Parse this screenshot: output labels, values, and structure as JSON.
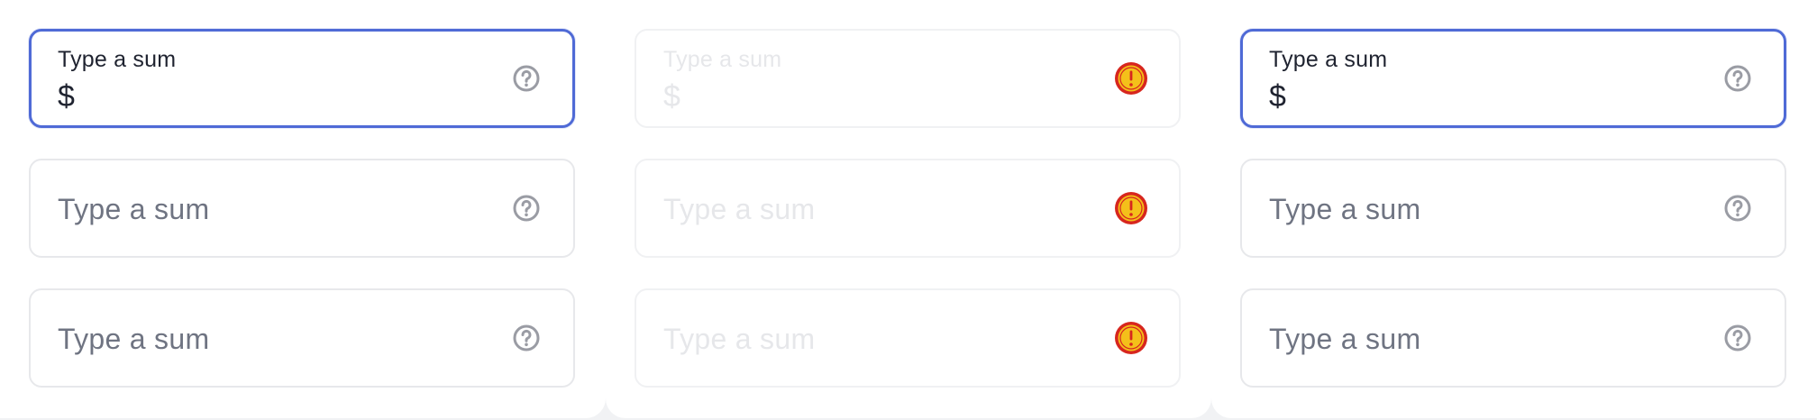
{
  "columns": [
    {
      "state": "focused-first",
      "fields": [
        {
          "label": "Type a sum",
          "prefix": "$",
          "icon": "question-circle-icon"
        },
        {
          "placeholder": "Type a sum",
          "icon": "question-circle-icon"
        },
        {
          "placeholder": "Type a sum",
          "icon": "question-circle-icon"
        }
      ]
    },
    {
      "state": "disabled",
      "fields": [
        {
          "label": "Type a sum",
          "prefix": "$",
          "icon": "warning-badge-icon"
        },
        {
          "placeholder": "Type a sum",
          "icon": "warning-badge-icon"
        },
        {
          "placeholder": "Type a sum",
          "icon": "warning-badge-icon"
        }
      ]
    },
    {
      "state": "focused-first",
      "fields": [
        {
          "label": "Type a sum",
          "prefix": "$",
          "icon": "question-circle-icon"
        },
        {
          "placeholder": "Type a sum",
          "icon": "question-circle-icon"
        },
        {
          "placeholder": "Type a sum",
          "icon": "question-circle-icon"
        }
      ]
    }
  ],
  "colors": {
    "focus_border": "#4f6ad6",
    "default_border": "#e7e8eb",
    "text": "#1f2330",
    "placeholder": "#6f7482",
    "disabled_text": "#e6e7ea",
    "help_icon": "#9a9ca4",
    "badge_outer": "#d7261e",
    "badge_inner": "#f4c01a"
  }
}
